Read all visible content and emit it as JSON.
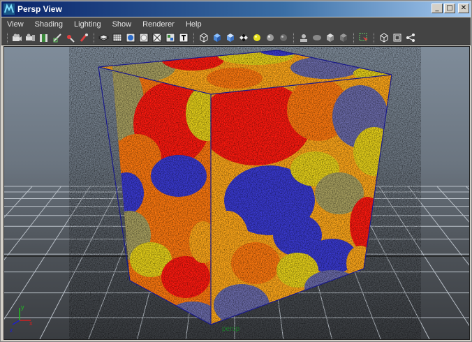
{
  "window": {
    "title": "Persp View",
    "minimize": "_",
    "maximize": "□",
    "close": "✕"
  },
  "menu": [
    "View",
    "Shading",
    "Lighting",
    "Show",
    "Renderer",
    "Help"
  ],
  "viewport": {
    "camera_label": "persp",
    "axis_labels": {
      "x": "x",
      "y": "y",
      "z": "z"
    }
  },
  "colors": {
    "title_from": "#0a246a",
    "title_to": "#a6caf0",
    "panel": "#444444",
    "cube_palette": [
      "#ff1a10",
      "#ff7a10",
      "#ffa81a",
      "#e8d21a",
      "#a8a060",
      "#3a3ad0",
      "#6a6aa8"
    ],
    "wireframe": "#1a1a8a"
  },
  "toolbar_icons": [
    "camera-icon",
    "camera-attrs-icon",
    "film-icon",
    "grid-snap-icon",
    "light-icon",
    "xray-icon",
    "layers-icon",
    "grid-icon",
    "shading-icon",
    "smooth-icon",
    "wireframe-icon",
    "texture-icon",
    "text-icon",
    "wire-cube-icon",
    "solid-cube-icon",
    "shaded-cube-icon",
    "checker-icon",
    "yellow-sphere-icon",
    "gray-sphere-icon",
    "dark-sphere-icon",
    "isolate-icon",
    "flat-sphere-icon",
    "light-cube-icon",
    "dark-cube-icon",
    "select-icon",
    "frame-icon",
    "box-icon",
    "share-icon"
  ]
}
